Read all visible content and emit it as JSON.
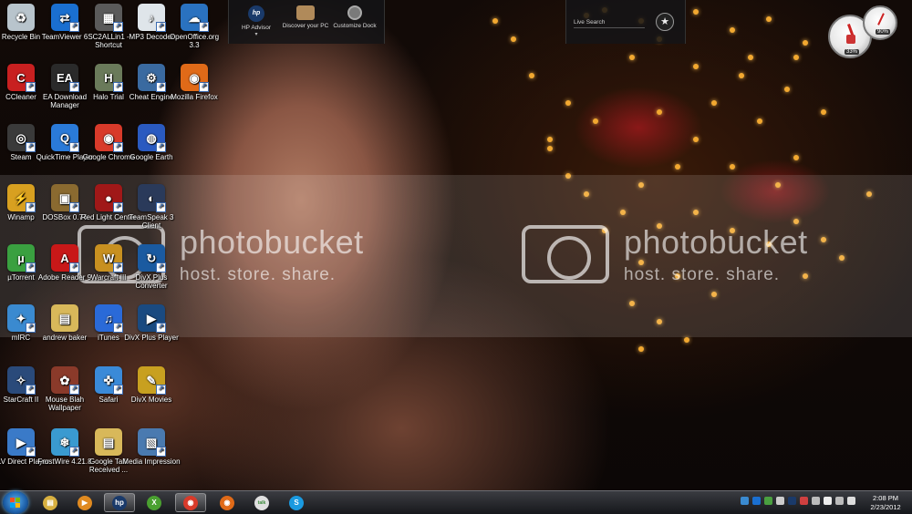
{
  "desktop": {
    "icons": [
      {
        "label": "Recycle Bin",
        "icon": "recycle-bin-icon",
        "color": "#b8c4cc",
        "glyph": "♻",
        "shortcut": false
      },
      {
        "label": "TeamViewer 6",
        "icon": "teamviewer-icon",
        "color": "#1a6fd0",
        "glyph": "⇄",
        "shortcut": true
      },
      {
        "label": "SC2ALLin1 - Shortcut",
        "icon": "sc2allin1-icon",
        "color": "#5a5a5a",
        "glyph": "▦",
        "shortcut": true
      },
      {
        "label": "MP3 Decoder",
        "icon": "mp3-decoder-icon",
        "color": "#dfe5ea",
        "glyph": "♪",
        "shortcut": true
      },
      {
        "label": "OpenOffice.org 3.3",
        "icon": "openoffice-icon",
        "color": "#2a72c0",
        "glyph": "☁",
        "shortcut": true
      },
      {
        "label": "CCleaner",
        "icon": "ccleaner-icon",
        "color": "#c82020",
        "glyph": "C",
        "shortcut": true
      },
      {
        "label": "EA Download Manager",
        "icon": "ea-icon",
        "color": "#2a2a2a",
        "glyph": "EA",
        "shortcut": true
      },
      {
        "label": "Halo Trial",
        "icon": "halo-icon",
        "color": "#6a7a5a",
        "glyph": "H",
        "shortcut": true
      },
      {
        "label": "Cheat Engine",
        "icon": "cheat-engine-icon",
        "color": "#3a6aa0",
        "glyph": "⚙",
        "shortcut": true
      },
      {
        "label": "Mozilla Firefox",
        "icon": "firefox-icon",
        "color": "#e06a18",
        "glyph": "◉",
        "shortcut": true
      },
      {
        "label": "Steam",
        "icon": "steam-icon",
        "color": "#3a3a3a",
        "glyph": "◎",
        "shortcut": true
      },
      {
        "label": "QuickTime Player",
        "icon": "quicktime-icon",
        "color": "#2a7ad8",
        "glyph": "Q",
        "shortcut": true
      },
      {
        "label": "Google Chrome",
        "icon": "chrome-icon",
        "color": "#d83a2a",
        "glyph": "◉",
        "shortcut": true
      },
      {
        "label": "Google Earth",
        "icon": "google-earth-icon",
        "color": "#2a5ac0",
        "glyph": "◍",
        "shortcut": true
      },
      {
        "label": "Winamp",
        "icon": "winamp-icon",
        "color": "#d8a020",
        "glyph": "⚡",
        "shortcut": true
      },
      {
        "label": "DOSBox 0.74",
        "icon": "dosbox-icon",
        "color": "#8a6a30",
        "glyph": "▣",
        "shortcut": true
      },
      {
        "label": "Red Light Center",
        "icon": "red-light-center-icon",
        "color": "#a01818",
        "glyph": "●",
        "shortcut": true
      },
      {
        "label": "TeamSpeak 3 Client",
        "icon": "teamspeak-icon",
        "color": "#2a3a5a",
        "glyph": "◐",
        "shortcut": true
      },
      {
        "label": "µTorrent",
        "icon": "utorrent-icon",
        "color": "#3aa040",
        "glyph": "µ",
        "shortcut": true
      },
      {
        "label": "Adobe Reader 9",
        "icon": "adobe-reader-icon",
        "color": "#c81818",
        "glyph": "A",
        "shortcut": true
      },
      {
        "label": "Warcraft III",
        "icon": "warcraft-icon",
        "color": "#c89020",
        "glyph": "W",
        "shortcut": true
      },
      {
        "label": "DivX Plus Converter",
        "icon": "divx-converter-icon",
        "color": "#1a5aa0",
        "glyph": "↻",
        "shortcut": true
      },
      {
        "label": "mIRC",
        "icon": "mirc-icon",
        "color": "#3a8ad0",
        "glyph": "✦",
        "shortcut": true
      },
      {
        "label": "andrew baker",
        "icon": "folder-icon",
        "color": "#d8b85a",
        "glyph": "▤",
        "shortcut": false
      },
      {
        "label": "iTunes",
        "icon": "itunes-icon",
        "color": "#2a6ad8",
        "glyph": "♫",
        "shortcut": true
      },
      {
        "label": "DivX Plus Player",
        "icon": "divx-player-icon",
        "color": "#1a4a80",
        "glyph": "▶",
        "shortcut": true
      },
      {
        "label": "StarCraft II",
        "icon": "starcraft-icon",
        "color": "#2a4a7a",
        "glyph": "✧",
        "shortcut": true
      },
      {
        "label": "Mouse Blah Wallpaper",
        "icon": "mouse-wallpaper-icon",
        "color": "#8a3a2a",
        "glyph": "✿",
        "shortcut": true
      },
      {
        "label": "Safari",
        "icon": "safari-icon",
        "color": "#3a8ad8",
        "glyph": "✜",
        "shortcut": true
      },
      {
        "label": "DivX Movies",
        "icon": "divx-movies-icon",
        "color": "#c8a020",
        "glyph": "✎",
        "shortcut": true
      },
      {
        "label": "FLV Direct Player",
        "icon": "flv-player-icon",
        "color": "#3a7ac8",
        "glyph": "▶",
        "shortcut": true
      },
      {
        "label": "FrostWire 4.21.8",
        "icon": "frostwire-icon",
        "color": "#3a9ad0",
        "glyph": "❄",
        "shortcut": true
      },
      {
        "label": "Google Talk Received ...",
        "icon": "folder-icon",
        "color": "#d8b85a",
        "glyph": "▤",
        "shortcut": false
      },
      {
        "label": "Media Impression",
        "icon": "media-impression-icon",
        "color": "#4a7ab0",
        "glyph": "▧",
        "shortcut": true
      }
    ]
  },
  "watermark": {
    "brand": "photobucket",
    "slogan": "host. store. share."
  },
  "hp_dock": {
    "items": [
      {
        "label": "HP Advisor",
        "icon": "hp-logo-icon",
        "color": "#1a3a6a"
      },
      {
        "label": "Discover your PC",
        "icon": "discover-pc-icon",
        "color": "#b08a5a"
      },
      {
        "label": "Customize Dock",
        "icon": "customize-dock-icon",
        "color": "#7a7a7a"
      }
    ]
  },
  "live_search": {
    "placeholder": "Live Search"
  },
  "gauges": [
    {
      "name": "cpu-gauge",
      "value": "33%"
    },
    {
      "name": "memory-gauge",
      "value": "90%"
    }
  ],
  "taskbar": {
    "apps": [
      {
        "name": "explorer",
        "icon": "explorer-folder-icon",
        "color": "#d8b040",
        "active": false
      },
      {
        "name": "media-player",
        "icon": "media-player-icon",
        "color": "#e08a20",
        "active": false
      },
      {
        "name": "hp",
        "icon": "hp-logo-icon",
        "color": "#1a3a6a",
        "active": true
      },
      {
        "name": "xbox",
        "icon": "xbox-icon",
        "color": "#4aa030",
        "active": false
      },
      {
        "name": "chrome",
        "icon": "chrome-icon",
        "color": "#d83a2a",
        "active": true
      },
      {
        "name": "firefox",
        "icon": "firefox-icon",
        "color": "#e06a18",
        "active": false
      },
      {
        "name": "google-talk",
        "icon": "google-talk-icon",
        "color": "#e0e0e0",
        "active": false
      },
      {
        "name": "skype",
        "icon": "skype-icon",
        "color": "#1a9ae0",
        "active": false
      }
    ],
    "clock_time": "2:08 PM",
    "clock_date": "2/23/2012"
  }
}
